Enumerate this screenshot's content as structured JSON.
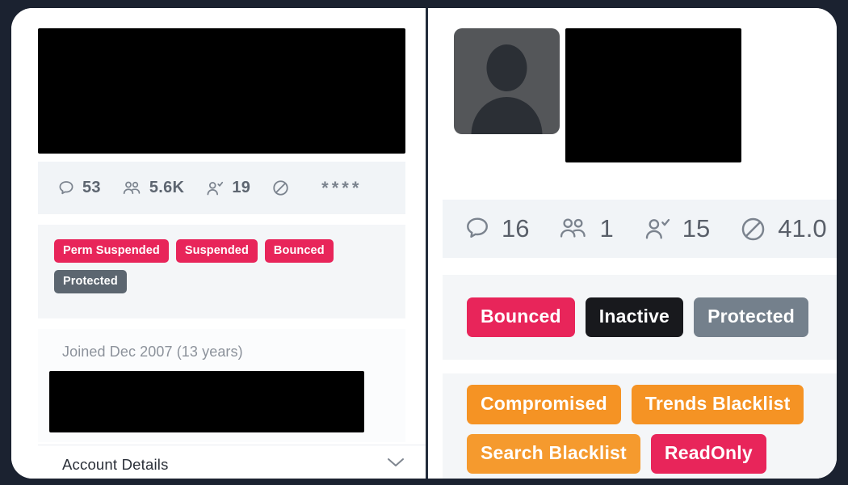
{
  "theme": {
    "outer_background": "#1b2230",
    "card_background": "#ffffff",
    "section_background": "#f1f4f7",
    "crimson": "#e8255a",
    "slate": "#74808c",
    "dark": "#18191d",
    "orange": "#f59324",
    "muted_text": "#8c929b",
    "stat_text": "#5d6570"
  },
  "left_panel": {
    "header_redaction": "redacted-account-header",
    "stats": [
      {
        "icon": "comment-icon",
        "value": "53",
        "label": "tweets"
      },
      {
        "icon": "followers-icon",
        "value": "5.6K",
        "label": "followers"
      },
      {
        "icon": "following-icon",
        "value": "19",
        "label": "following"
      },
      {
        "icon": "blocked-icon",
        "value": "",
        "label": "blocked"
      }
    ],
    "stats_overflow": "****",
    "badges": [
      {
        "text": "Perm Suspended",
        "color": "#e8255a"
      },
      {
        "text": "Suspended",
        "color": "#e8255a"
      },
      {
        "text": "Bounced",
        "color": "#e8255a"
      },
      {
        "text": "Protected",
        "color": "#5c6670"
      }
    ],
    "joined": "Joined Dec 2007 (13 years)",
    "lower_redaction": "redacted-account-body",
    "account_details_label": "Account Details",
    "account_details_chevron": "chevron-down-icon"
  },
  "right_panel": {
    "avatar": "default-avatar-placeholder",
    "header_redaction": "redacted-account-header",
    "stats": [
      {
        "icon": "comment-icon",
        "value": "16",
        "label": "tweets"
      },
      {
        "icon": "followers-icon",
        "value": "1",
        "label": "followers"
      },
      {
        "icon": "following-icon",
        "value": "15",
        "label": "following"
      },
      {
        "icon": "blocked-icon",
        "value": "41.0",
        "label": "blocked"
      }
    ],
    "badges_primary": [
      {
        "text": "Bounced",
        "color": "#e8255a"
      },
      {
        "text": "Inactive",
        "color": "#18191d"
      },
      {
        "text": "Protected",
        "color": "#74808c"
      }
    ],
    "badges_secondary": [
      {
        "text": "Compromised",
        "color": "#f59324"
      },
      {
        "text": "Trends Blacklist",
        "color": "#f59324"
      },
      {
        "text": "Search Blacklist",
        "color": "#f59a2e"
      },
      {
        "text": "ReadOnly",
        "color": "#e8255a"
      }
    ]
  }
}
